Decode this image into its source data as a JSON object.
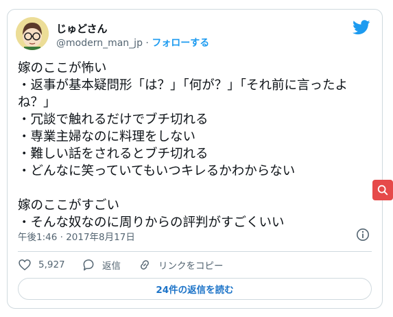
{
  "author": {
    "name": "じゅどさん",
    "handle": "@modern_man_jp",
    "separator": " · ",
    "follow_label": "フォローする"
  },
  "tweet": {
    "text": "嫁のここが怖い\n・返事が基本疑問形「は？」「何が？」「それ前に言ったよね？」\n・冗談で触れるだけでブチ切れる\n・専業主婦なのに料理をしない\n・難しい話をされるとブチ切れる\n・どんなに笑っていてもいつキレるかわからない\n\n嫁のここがすごい\n・そんな奴なのに周りからの評判がすごくいい",
    "timestamp": "午後1:46 · 2017年8月17日"
  },
  "actions": {
    "like_count": "5,927",
    "reply_label": "返信",
    "link_label": "リンクをコピー"
  },
  "read_replies_label": "24件の返信を読む",
  "icons": {
    "brand": "twitter-bird-icon",
    "info": "info-icon",
    "like": "heart-icon",
    "reply": "speech-bubble-icon",
    "link": "link-icon",
    "search": "search-icon"
  },
  "colors": {
    "accent": "#1d9bf0",
    "side_button": "#e64a4a"
  }
}
